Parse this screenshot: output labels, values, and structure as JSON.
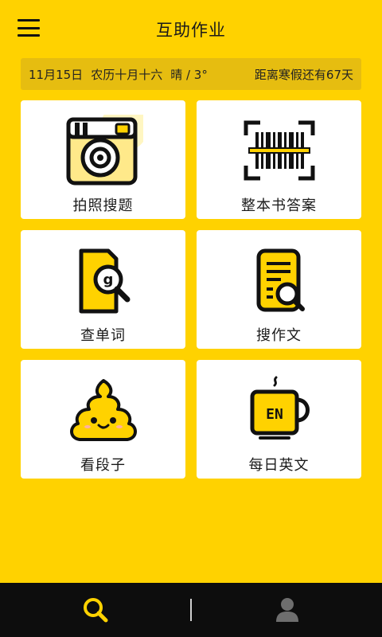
{
  "header": {
    "title": "互助作业",
    "menu_icon": "menu-icon"
  },
  "info_bar": {
    "date": "11月15日",
    "lunar": "农历十月十六",
    "weather": "晴 / 3°",
    "countdown": "距离寒假还有67天"
  },
  "tiles": [
    {
      "label": "拍照搜题",
      "icon": "camera-icon"
    },
    {
      "label": "整本书答案",
      "icon": "barcode-scan-icon"
    },
    {
      "label": "查单词",
      "icon": "word-search-icon"
    },
    {
      "label": "搜作文",
      "icon": "document-search-icon"
    },
    {
      "label": "看段子",
      "icon": "poop-emoji-icon"
    },
    {
      "label": "每日英文",
      "icon": "english-cup-icon"
    }
  ],
  "bottom_nav": [
    {
      "name": "search",
      "icon": "search-icon",
      "active": true
    },
    {
      "name": "profile",
      "icon": "user-icon",
      "active": false
    }
  ],
  "colors": {
    "brand_yellow": "#FFD200",
    "info_bar": "#E6BD10",
    "nav_bg": "#0d0d0d",
    "active_icon": "#FFD200",
    "inactive_icon": "#6e6e6e"
  }
}
